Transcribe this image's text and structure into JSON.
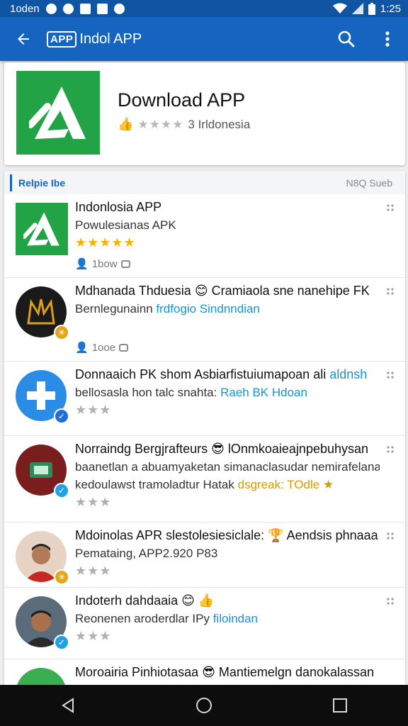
{
  "status_bar": {
    "carrier": "1oden",
    "time": "1:25"
  },
  "app_bar": {
    "logo_box": "APP",
    "title": "Indol APP",
    "icons": [
      "back-arrow-icon",
      "search-icon",
      "more-vert-icon"
    ]
  },
  "header": {
    "title": "Download APP",
    "meta": "3 Irldonesia",
    "rating_stars": "★★★★",
    "icon": "app-logo-a-icon"
  },
  "section": {
    "title": "Relpie Ibe",
    "right_label": "N8Q Sueb"
  },
  "rows": [
    {
      "line1": "Indonlosia APP",
      "line2": "Powulesianas APK",
      "stars": "★★★★★",
      "meta": "1bow"
    },
    {
      "line1": "Mdhanada Thduesia",
      "line1_tail": "Cramiaola sne nanehipe FK",
      "line2_pre": "Bernlegunainn ",
      "line2_hl": "frdfogio Sindnndian",
      "meta": "1ooe"
    },
    {
      "line1": "Donnaaich PK shom Asbiarfistuiumapoan ali ",
      "line1_hl": "aldnsh",
      "line2_pre": "bellosasla hon talc snahta: ",
      "line2_hl": "Raeh BK Hdoan",
      "stars": "★★★"
    },
    {
      "line1": "Norraindg Bergjrafteurs",
      "line1_tail": "lOnmkoaieajnpebuhysan",
      "line2": "baanetlan a abuamyaketan simanaclasudar nemirafelana",
      "line3_pre": "kedoulawst tramoladtur Hatak ",
      "line3_gold": "dsgreak: TOdle",
      "stars": "★★★"
    },
    {
      "line1": "Mdoinolas APR slestolesiesiclale:",
      "line1_tail": "Aendsis phnaaa",
      "line2": "Pemataing, APP2.920 P83",
      "stars": "★★★"
    },
    {
      "line1": "Indoterh dahdaaia",
      "line2_pre": "Reonenen aroderdlar IPy ",
      "line2_hl": "filoindan",
      "stars": "★★★"
    },
    {
      "line1": "Moroairia Pinhiotasaa",
      "line1_tail": "Mantiemelgn danokalassan"
    }
  ],
  "colors": {
    "app_bar": "#1565c0",
    "status_bar": "#0f55a3",
    "app_green": "#22a345",
    "star_gold": "#f2b400",
    "link_blue": "#1793d1"
  }
}
